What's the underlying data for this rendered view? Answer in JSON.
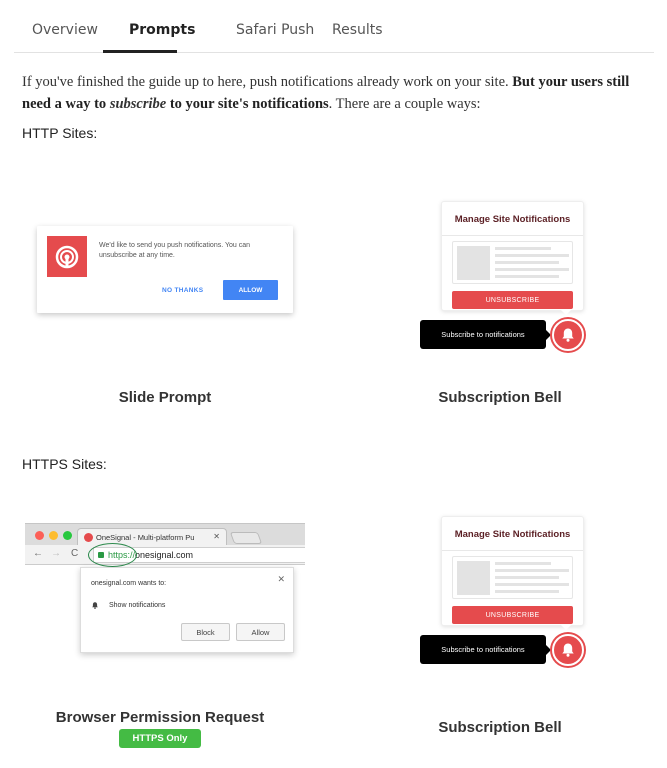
{
  "tabs": [
    {
      "label": "Overview",
      "active": false
    },
    {
      "label": "Prompts",
      "active": true
    },
    {
      "label": "Safari Push",
      "active": false
    },
    {
      "label": "Results",
      "active": false
    }
  ],
  "intro": {
    "part1": "If you've finished the guide up to here, push notifications already work on your site. ",
    "bold1": "But your users still need a way to ",
    "italic": "subscribe",
    "bold2": " to your site's notifications",
    "part2": ". There are a couple ways:"
  },
  "sections": {
    "http_heading": "HTTP Sites:",
    "https_heading": "HTTPS Sites:"
  },
  "slide_prompt": {
    "message": "We'd like to send you push notifications. You can unsubscribe at any time.",
    "no_thanks": "NO THANKS",
    "allow": "ALLOW",
    "caption": "Slide Prompt"
  },
  "bell": {
    "title": "Manage Site Notifications",
    "unsubscribe": "UNSUBSCRIBE",
    "tooltip": "Subscribe to notifications",
    "caption": "Subscription Bell"
  },
  "browser_permission": {
    "tab_title": "OneSignal - Multi-platform Pu",
    "url_scheme": "https://",
    "url_host": "onesignal.com",
    "popup_title": "onesignal.com wants to:",
    "permission": "Show notifications",
    "block": "Block",
    "allow": "Allow",
    "caption": "Browser Permission Request",
    "badge": "HTTPS Only"
  },
  "colors": {
    "brand_red": "#e54b4d",
    "allow_blue": "#4285f4",
    "badge_green": "#44bb44"
  }
}
